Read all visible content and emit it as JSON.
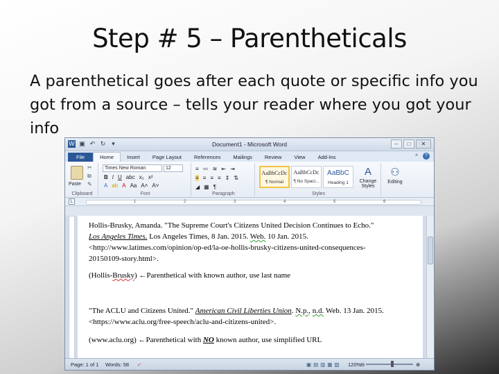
{
  "slide": {
    "title": "Step # 5 – Parentheticals",
    "body": "A parenthetical goes after each quote or specific info you got from a source – tells your reader where you got your info"
  },
  "window": {
    "title": "Document1 - Microsoft Word",
    "tabs": [
      "File",
      "Home",
      "Insert",
      "Page Layout",
      "References",
      "Mailings",
      "Review",
      "View",
      "Add-Ins"
    ],
    "active_tab": "Home"
  },
  "ribbon": {
    "clipboard_label": "Clipboard",
    "paste_label": "Paste",
    "font_name": "Times New Roman",
    "font_size": "12",
    "font_label": "Font",
    "paragraph_label": "Paragraph",
    "styles_label": "Styles",
    "styles": [
      {
        "preview": "AaBbCcDc",
        "name": "¶ Normal"
      },
      {
        "preview": "AaBbCcDc",
        "name": "¶ No Spaci..."
      },
      {
        "preview": "AaBbC",
        "name": "Heading 1"
      }
    ],
    "change_styles_label": "Change Styles",
    "editing_label": "Editing"
  },
  "ruler_numbers": [
    "1",
    "2",
    "3",
    "4",
    "5",
    "6"
  ],
  "document": {
    "c1_line1": "Hollis-Brusky, Amanda. \"The Supreme Court's Citizens United Decision Continues to Echo.\"",
    "c1_line2_pub": "Los Angeles Times.",
    "c1_line2_rest": " Los Angeles Times, 8 Jan. 2015. ",
    "c1_line2_web": "Web.",
    "c1_line2_end": " 10 Jan. 2015.",
    "c1_line3": "<http://www.latimes.com/opinion/op-ed/la-oe-hollis-brusky-citizens-united-consequences-",
    "c1_line4": "20150109-story.html>.",
    "p2_open": "(Hollis-",
    "p2_name": "Brusky",
    "p2_rest": ") ←Parenthetical with known author, use last name",
    "c2_a": "\"The ACLU and Citizens United.\" ",
    "c2_pub": "American Civil Liberties Union",
    "c2_b": ". ",
    "c2_np": "N.p.",
    "c2_c": ", ",
    "c2_nd": "n.d.",
    "c2_d": " Web. 13 Jan. 2015.",
    "c2_line2": "<https://www.aclu.org/free-speech/aclu-and-citizens-united>.",
    "p4_a": "(www.aclu.org) ←Parenthetical with ",
    "p4_no": "NO",
    "p4_b": " known author, use simplified URL"
  },
  "status": {
    "page": "Page: 1 of 1",
    "words": "Words: 58",
    "zoom": "120%"
  }
}
